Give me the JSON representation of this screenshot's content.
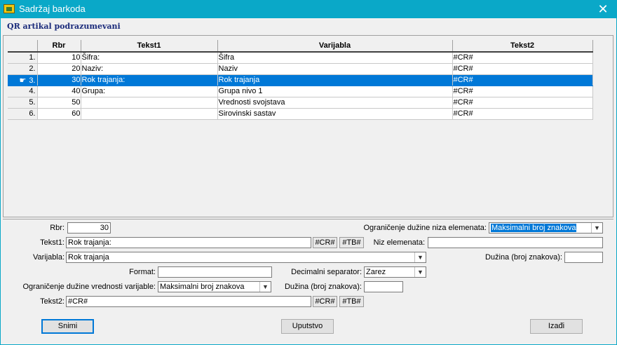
{
  "window": {
    "title": "Sadržaj barkoda",
    "close_label": "✕"
  },
  "subtitle": "QR artikal podrazumevani",
  "grid": {
    "headers": [
      "Rbr",
      "Tekst1",
      "Varijabla",
      "Tekst2"
    ],
    "rows": [
      {
        "num": "1.",
        "rbr": "10",
        "tekst1": "Šifra:",
        "varijabla": "Šifra",
        "tekst2": "#CR#"
      },
      {
        "num": "2.",
        "rbr": "20",
        "tekst1": "Naziv:",
        "varijabla": "Naziv",
        "tekst2": "#CR#"
      },
      {
        "num": "3.",
        "rbr": "30",
        "tekst1": "Rok trajanja:",
        "varijabla": "Rok trajanja",
        "tekst2": "#CR#"
      },
      {
        "num": "4.",
        "rbr": "40",
        "tekst1": "Grupa:",
        "varijabla": "Grupa nivo 1",
        "tekst2": "#CR#"
      },
      {
        "num": "5.",
        "rbr": "50",
        "tekst1": "",
        "varijabla": "Vrednosti svojstava",
        "tekst2": "#CR#"
      },
      {
        "num": "6.",
        "rbr": "60",
        "tekst1": "",
        "varijabla": "Sirovinski sastav",
        "tekst2": "#CR#"
      }
    ],
    "selected_row": 2
  },
  "form": {
    "rbr_label": "Rbr:",
    "rbr_value": "30",
    "tekst1_label": "Tekst1:",
    "tekst1_value": "Rok trajanja:",
    "varijabla_label": "Varijabla:",
    "varijabla_value": "Rok trajanja",
    "format_label": "Format:",
    "format_value": "",
    "decimal_label": "Decimalni separator:",
    "decimal_value": "Zarez",
    "ogr_vrednosti_label": "Ograničenje dužine vrednosti varijable:",
    "ogr_vrednosti_value": "Maksimalni broj znakova",
    "duzina2_label": "Dužina (broj znakova):",
    "duzina2_value": "",
    "tekst2_label": "Tekst2:",
    "tekst2_value": "#CR#",
    "ogr_niza_label": "Ograničenje dužine niza elemenata:",
    "ogr_niza_value": "Maksimalni broj znakova",
    "niz_label": "Niz elemenata:",
    "niz_value": "",
    "duzina1_label": "Dužina (broj znakova):",
    "duzina1_value": "",
    "cr_button": "#CR#",
    "tb_button": "#TB#"
  },
  "buttons": {
    "snimi": "Snimi",
    "uputstvo": "Uputstvo",
    "izadji": "Izađi"
  },
  "icons": {
    "app": "barcode-app-icon",
    "close": "close-icon",
    "pointer": "hand-pointer-icon",
    "dropdown": "chevron-down-icon"
  },
  "colors": {
    "titlebar": "#0aa8c8",
    "selection": "#0078d7",
    "subtitle": "#1a2a7a"
  }
}
